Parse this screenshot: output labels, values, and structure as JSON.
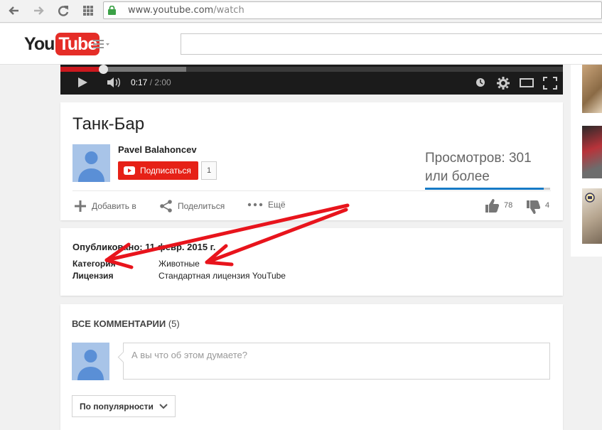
{
  "browser": {
    "url_host": "www.youtube.com",
    "url_path": "/watch",
    "icons": [
      "back-icon",
      "forward-icon",
      "reload-icon",
      "apps-icon",
      "lock-icon"
    ]
  },
  "masthead": {
    "logo_you": "You",
    "logo_tube": "Tube",
    "search_placeholder": ""
  },
  "player": {
    "time_current": "0:17",
    "time_separator": " / ",
    "time_duration": "2:00",
    "played_fraction": 0.085,
    "buffered_fraction": 0.25,
    "colors": {
      "played": "#cc181e"
    }
  },
  "video": {
    "title": "Танк-Бар",
    "channel": "Pavel Balahoncev",
    "subscribe_label": "Подписаться",
    "subscriber_count": "1",
    "views_text": "Просмотров: 301 или более",
    "actions": {
      "add_to": "Добавить в",
      "share": "Поделиться",
      "more": "Ещё"
    },
    "likes": "78",
    "dislikes": "4",
    "like_ratio": 0.95
  },
  "details": {
    "published": "Опубликовано: 11 февр. 2015 г.",
    "category_label": "Категория",
    "category_value": "Животные",
    "license_label": "Лицензия",
    "license_value": "Стандартная лицензия YouTube"
  },
  "comments": {
    "header": "ВСЕ КОММЕНТАРИИ",
    "count": "(5)",
    "placeholder": "А вы что об этом думаете?",
    "sort_label": "По популярности"
  },
  "colors": {
    "brand_red": "#e52d27",
    "subscribe_red": "#e62117",
    "annotation_red": "#e8141c",
    "view_bar_blue": "#167ac6"
  }
}
